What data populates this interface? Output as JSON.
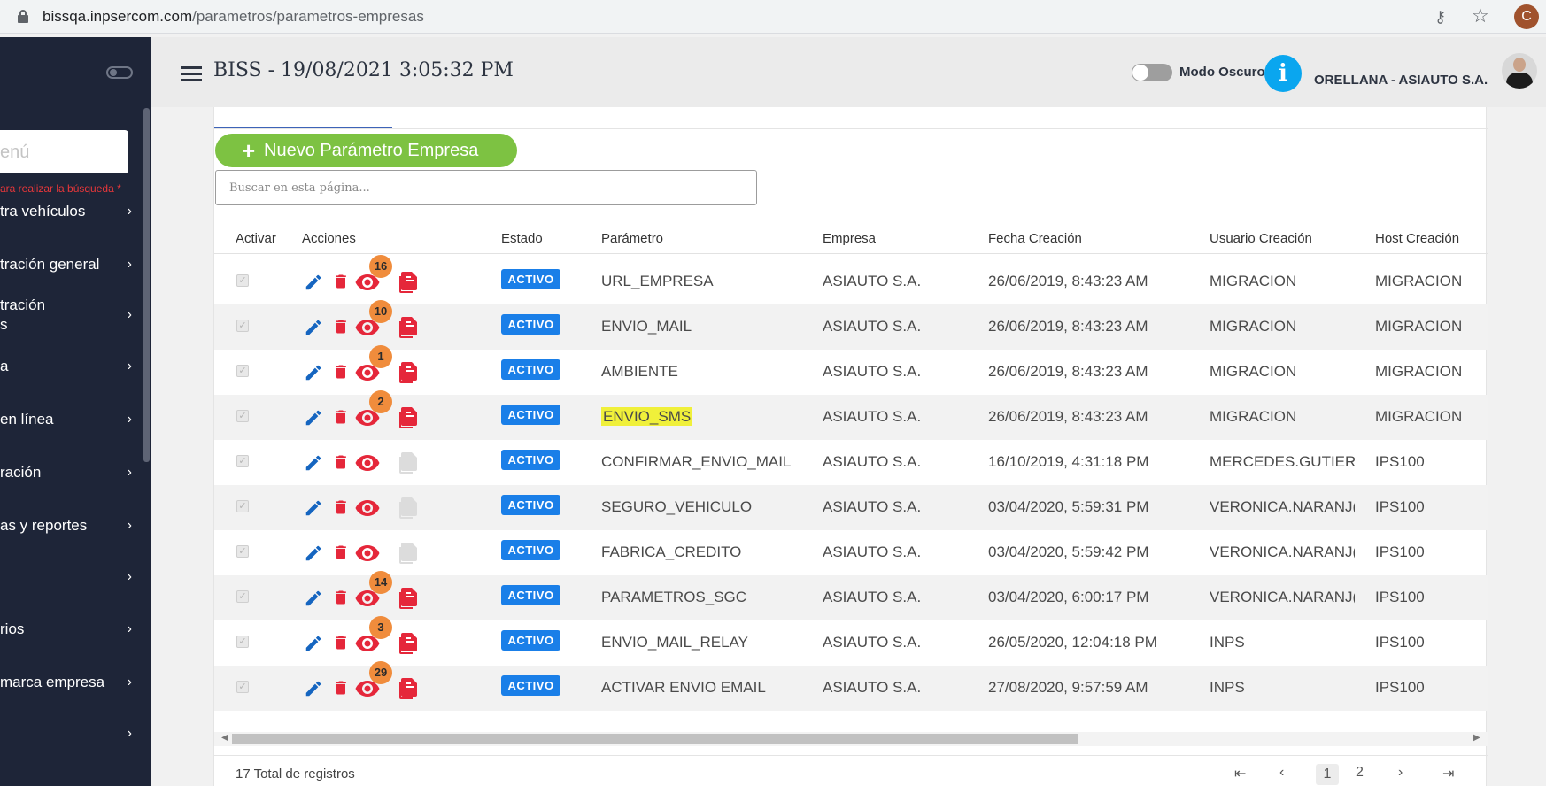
{
  "browser": {
    "url_host": "bissqa.inpsercom.com",
    "url_path": "/parametros/parametros-empresas",
    "profile_initial": "C"
  },
  "sidebar": {
    "search_placeholder": "enú",
    "search_hint": "ara realizar la búsqueda *",
    "items": [
      {
        "label": "tra vehículos"
      },
      {
        "label": "tración general"
      },
      {
        "label": "tración\ns"
      },
      {
        "label": "a"
      },
      {
        "label": "en línea"
      },
      {
        "label": "ración"
      },
      {
        "label": "as y reportes"
      },
      {
        "label": ""
      },
      {
        "label": "rios"
      },
      {
        "label": "marca empresa"
      },
      {
        "label": ""
      }
    ]
  },
  "header": {
    "title": "BISS - 19/08/2021 3:05:32 PM",
    "dark_mode_label": "Modo Oscuro",
    "info_label": "i",
    "user_label": "ORELLANA - ASIAUTO S.A."
  },
  "toolbar": {
    "new_button_label": "Nuevo Parámetro Empresa",
    "search_placeholder": "Buscar en esta página..."
  },
  "table": {
    "headers": [
      "Activar",
      "Acciones",
      "Estado",
      "Parámetro",
      "Empresa",
      "Fecha Creación",
      "Usuario Creación",
      "Host Creación"
    ],
    "rows": [
      {
        "count": "16",
        "copy_active": true,
        "estado": "ACTIVO",
        "parametro": "URL_EMPRESA",
        "empresa": "ASIAUTO S.A.",
        "fecha": "26/06/2019, 8:43:23 AM",
        "usuario": "MIGRACION",
        "host": "MIGRACION",
        "highlight": false
      },
      {
        "count": "10",
        "copy_active": true,
        "estado": "ACTIVO",
        "parametro": "ENVIO_MAIL",
        "empresa": "ASIAUTO S.A.",
        "fecha": "26/06/2019, 8:43:23 AM",
        "usuario": "MIGRACION",
        "host": "MIGRACION",
        "highlight": false
      },
      {
        "count": "1",
        "copy_active": true,
        "estado": "ACTIVO",
        "parametro": "AMBIENTE",
        "empresa": "ASIAUTO S.A.",
        "fecha": "26/06/2019, 8:43:23 AM",
        "usuario": "MIGRACION",
        "host": "MIGRACION",
        "highlight": false
      },
      {
        "count": "2",
        "copy_active": true,
        "estado": "ACTIVO",
        "parametro": "ENVIO_SMS",
        "empresa": "ASIAUTO S.A.",
        "fecha": "26/06/2019, 8:43:23 AM",
        "usuario": "MIGRACION",
        "host": "MIGRACION",
        "highlight": true
      },
      {
        "count": "",
        "copy_active": false,
        "estado": "ACTIVO",
        "parametro": "CONFIRMAR_ENVIO_MAIL",
        "empresa": "ASIAUTO S.A.",
        "fecha": "16/10/2019, 4:31:18 PM",
        "usuario": "MERCEDES.GUTIERR",
        "host": "IPS100",
        "highlight": false
      },
      {
        "count": "",
        "copy_active": false,
        "estado": "ACTIVO",
        "parametro": "SEGURO_VEHICULO",
        "empresa": "ASIAUTO S.A.",
        "fecha": "03/04/2020, 5:59:31 PM",
        "usuario": "VERONICA.NARANJ(",
        "host": "IPS100",
        "highlight": false
      },
      {
        "count": "",
        "copy_active": false,
        "estado": "ACTIVO",
        "parametro": "FABRICA_CREDITO",
        "empresa": "ASIAUTO S.A.",
        "fecha": "03/04/2020, 5:59:42 PM",
        "usuario": "VERONICA.NARANJ(",
        "host": "IPS100",
        "highlight": false
      },
      {
        "count": "14",
        "copy_active": true,
        "estado": "ACTIVO",
        "parametro": "PARAMETROS_SGC",
        "empresa": "ASIAUTO S.A.",
        "fecha": "03/04/2020, 6:00:17 PM",
        "usuario": "VERONICA.NARANJ(",
        "host": "IPS100",
        "highlight": false
      },
      {
        "count": "3",
        "copy_active": true,
        "estado": "ACTIVO",
        "parametro": "ENVIO_MAIL_RELAY",
        "empresa": "ASIAUTO S.A.",
        "fecha": "26/05/2020, 12:04:18 PM",
        "usuario": "INPS",
        "host": "IPS100",
        "highlight": false
      },
      {
        "count": "29",
        "copy_active": true,
        "estado": "ACTIVO",
        "parametro": "ACTIVAR ENVIO EMAIL",
        "empresa": "ASIAUTO S.A.",
        "fecha": "27/08/2020, 9:57:59 AM",
        "usuario": "INPS",
        "host": "IPS100",
        "highlight": false
      }
    ]
  },
  "footer": {
    "total_label": "17 Total de registros",
    "pages": [
      "1",
      "2"
    ],
    "current_page": "1"
  },
  "colors": {
    "sidebar_bg": "#1e2538",
    "accent_green": "#7dc242",
    "status_blue": "#1a7fe8",
    "action_red": "#e5273a",
    "edit_blue": "#1565c0",
    "count_orange": "#f08c3c"
  }
}
